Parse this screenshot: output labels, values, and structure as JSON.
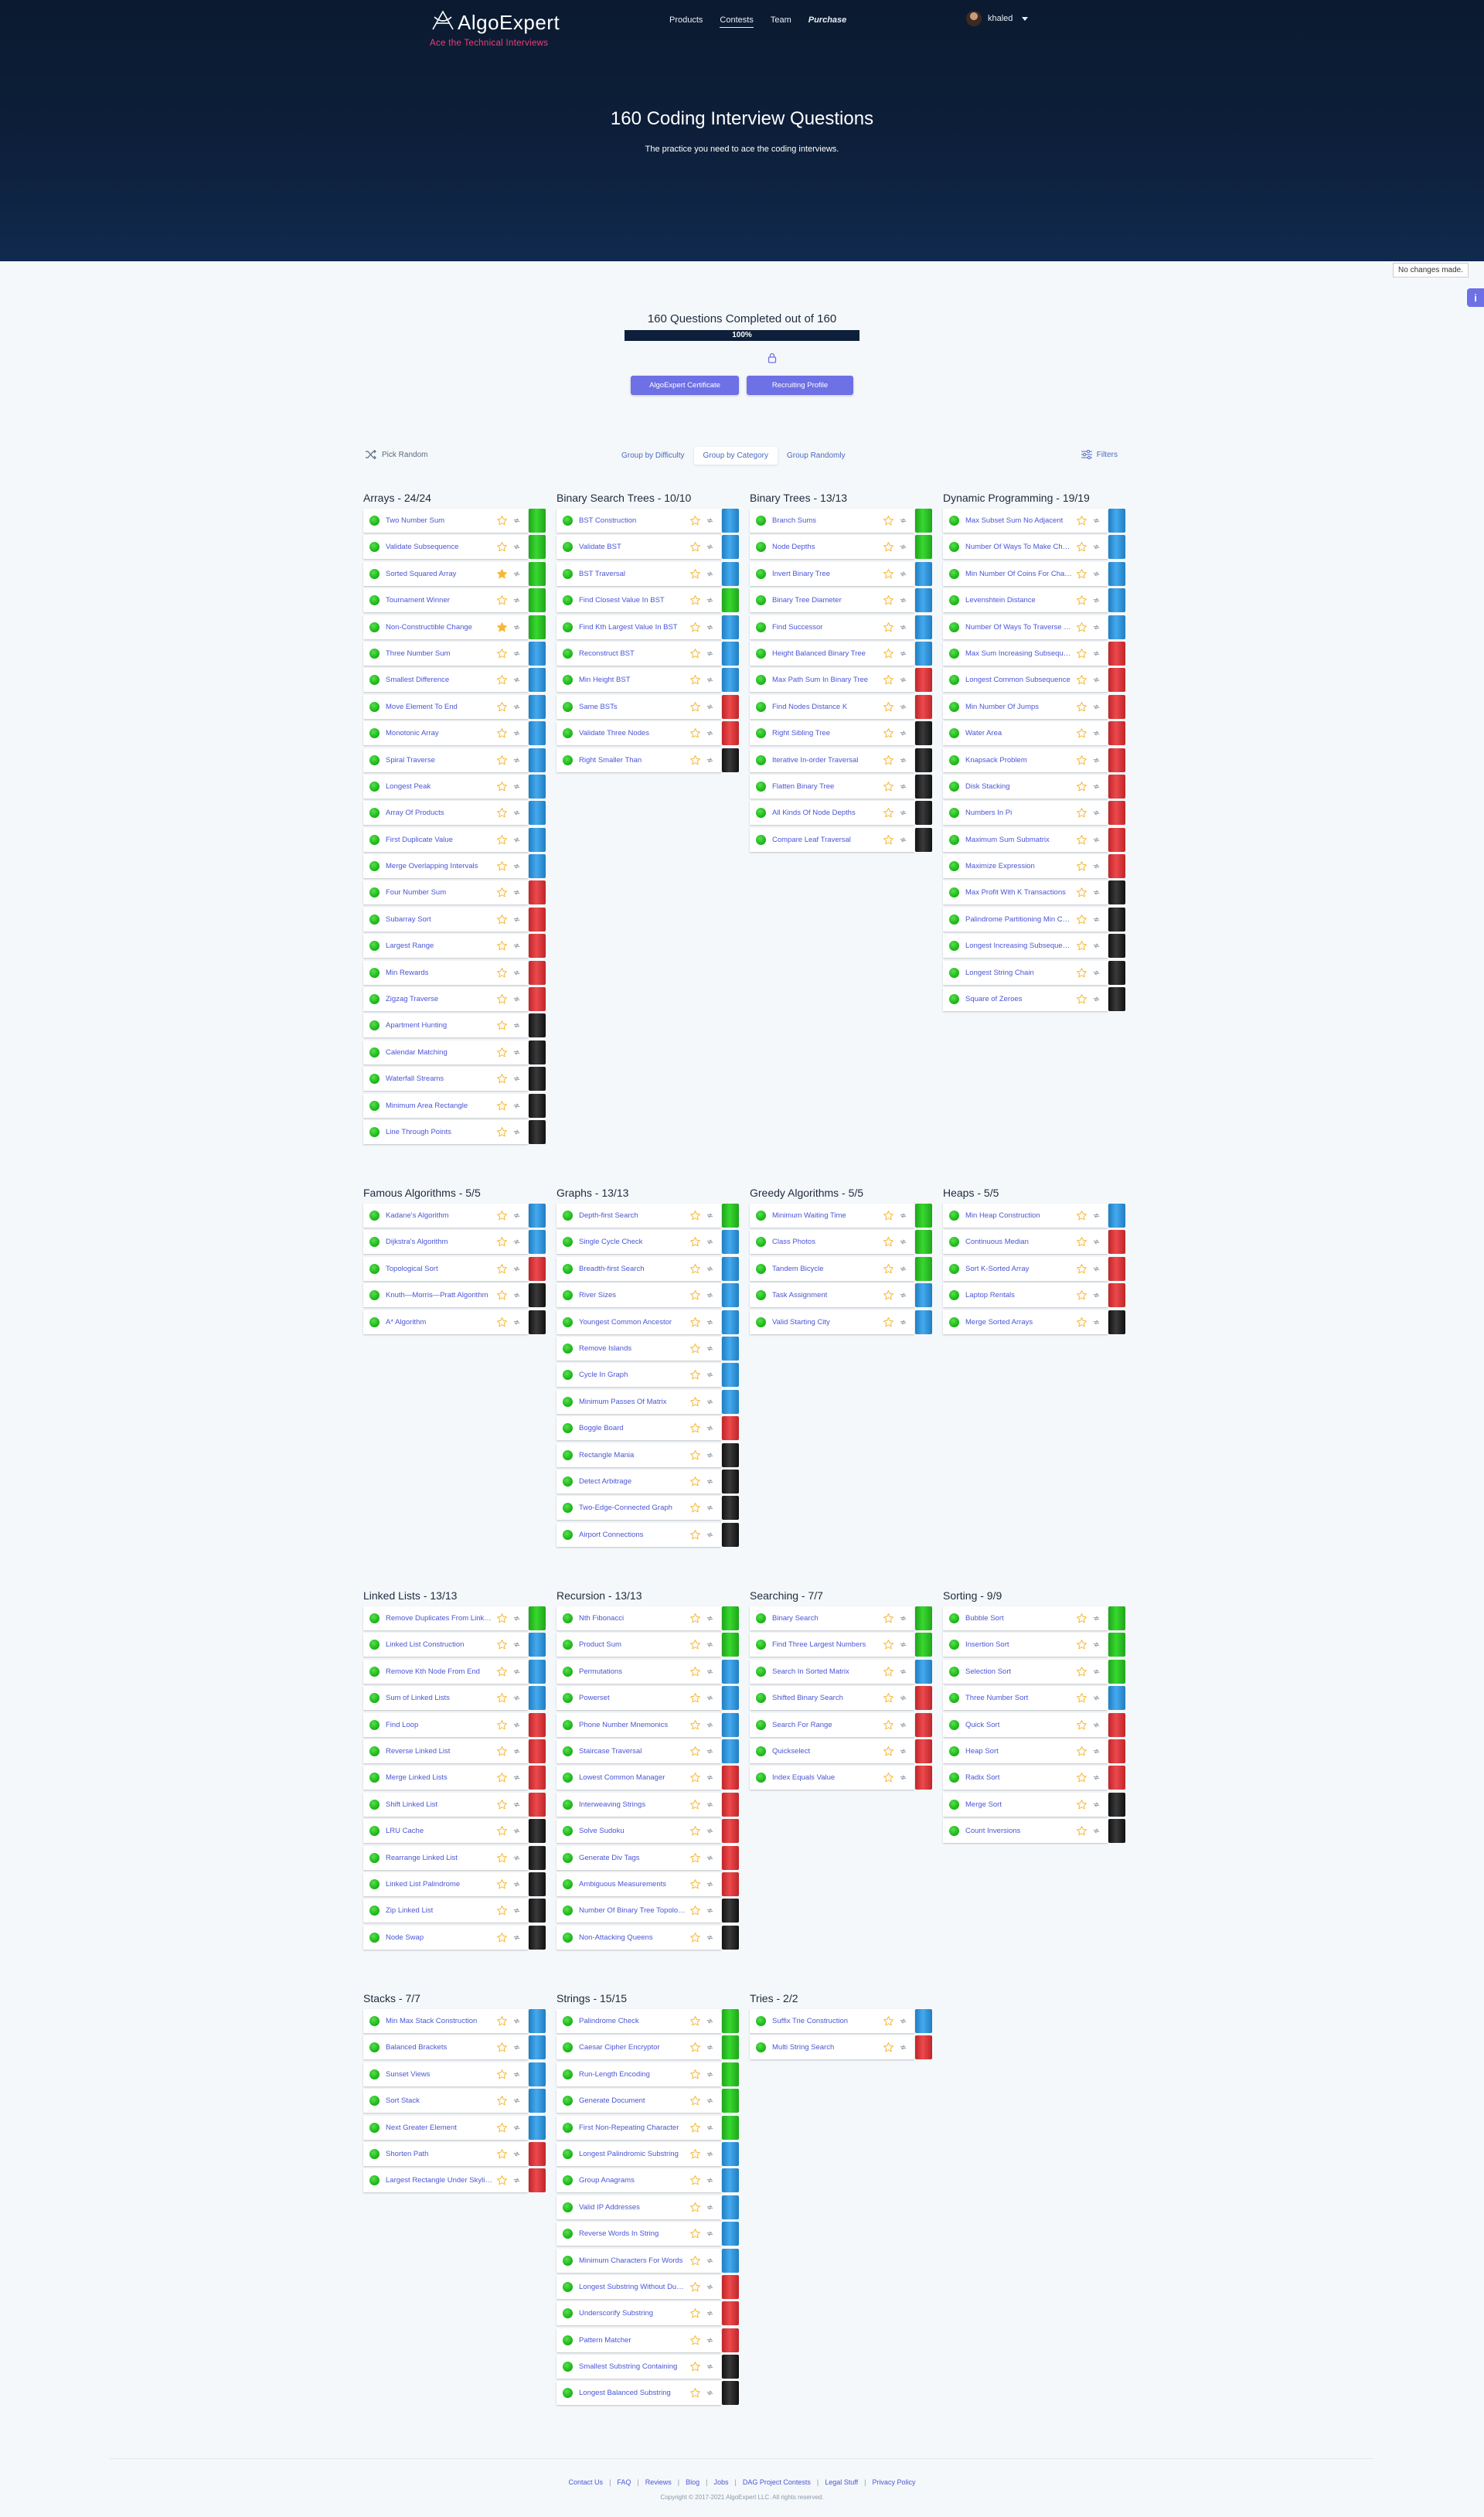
{
  "brand": {
    "name": "AlgoExpert",
    "tagline": "Ace the Technical Interviews"
  },
  "nav": {
    "products": "Products",
    "contests": "Contests",
    "team": "Team",
    "purchase": "Purchase"
  },
  "user": {
    "name": "khaled"
  },
  "hero": {
    "title": "160 Coding Interview Questions",
    "subtitle": "The practice you need to ace the coding interviews."
  },
  "toast": "No changes made.",
  "progress": {
    "title": "160 Questions Completed out of 160",
    "label": "100%",
    "fraction": 1.0
  },
  "cta": {
    "certificate": "AlgoExpert Certificate",
    "profile": "Recruiting Profile"
  },
  "toolbar": {
    "pick_random": "Pick Random",
    "group_by_difficulty": "Group by Difficulty",
    "group_by_category": "Group by Category",
    "group_randomly": "Group Randomly",
    "filters": "Filters"
  },
  "colors": {
    "easy": "#2fc62a",
    "medium": "#3a9be0",
    "hard": "#e03b3e",
    "very_hard": "#2a2a2a",
    "accent": "#6e70e5"
  },
  "categories": [
    {
      "name": "Arrays",
      "count": "24/24",
      "questions": [
        [
          "Two Number Sum",
          "easy",
          0
        ],
        [
          "Validate Subsequence",
          "easy",
          0
        ],
        [
          "Sorted Squared Array",
          "easy",
          1
        ],
        [
          "Tournament Winner",
          "easy",
          0
        ],
        [
          "Non-Constructible Change",
          "easy",
          1
        ],
        [
          "Three Number Sum",
          "medium",
          0
        ],
        [
          "Smallest Difference",
          "medium",
          0
        ],
        [
          "Move Element To End",
          "medium",
          0
        ],
        [
          "Monotonic Array",
          "medium",
          0
        ],
        [
          "Spiral Traverse",
          "medium",
          0
        ],
        [
          "Longest Peak",
          "medium",
          0
        ],
        [
          "Array Of Products",
          "medium",
          0
        ],
        [
          "First Duplicate Value",
          "medium",
          0
        ],
        [
          "Merge Overlapping Intervals",
          "medium",
          0
        ],
        [
          "Four Number Sum",
          "hard",
          0
        ],
        [
          "Subarray Sort",
          "hard",
          0
        ],
        [
          "Largest Range",
          "hard",
          0
        ],
        [
          "Min Rewards",
          "hard",
          0
        ],
        [
          "Zigzag Traverse",
          "hard",
          0
        ],
        [
          "Apartment Hunting",
          "very_hard",
          0
        ],
        [
          "Calendar Matching",
          "very_hard",
          0
        ],
        [
          "Waterfall Streams",
          "very_hard",
          0
        ],
        [
          "Minimum Area Rectangle",
          "very_hard",
          0
        ],
        [
          "Line Through Points",
          "very_hard",
          0
        ]
      ]
    },
    {
      "name": "Binary Search Trees",
      "count": "10/10",
      "questions": [
        [
          "BST Construction",
          "medium",
          0
        ],
        [
          "Validate BST",
          "medium",
          0
        ],
        [
          "BST Traversal",
          "medium",
          0
        ],
        [
          "Find Closest Value In BST",
          "easy",
          0
        ],
        [
          "Find Kth Largest Value In BST",
          "medium",
          0
        ],
        [
          "Reconstruct BST",
          "medium",
          0
        ],
        [
          "Min Height BST",
          "medium",
          0
        ],
        [
          "Same BSTs",
          "hard",
          0
        ],
        [
          "Validate Three Nodes",
          "hard",
          0
        ],
        [
          "Right Smaller Than",
          "very_hard",
          0
        ]
      ]
    },
    {
      "name": "Binary Trees",
      "count": "13/13",
      "questions": [
        [
          "Branch Sums",
          "easy",
          0
        ],
        [
          "Node Depths",
          "easy",
          0
        ],
        [
          "Invert Binary Tree",
          "medium",
          0
        ],
        [
          "Binary Tree Diameter",
          "medium",
          0
        ],
        [
          "Find Successor",
          "medium",
          0
        ],
        [
          "Height Balanced Binary Tree",
          "medium",
          0
        ],
        [
          "Max Path Sum In Binary Tree",
          "hard",
          0
        ],
        [
          "Find Nodes Distance K",
          "hard",
          0
        ],
        [
          "Right Sibling Tree",
          "very_hard",
          0
        ],
        [
          "Iterative In-order Traversal",
          "very_hard",
          0
        ],
        [
          "Flatten Binary Tree",
          "very_hard",
          0
        ],
        [
          "All Kinds Of Node Depths",
          "very_hard",
          0
        ],
        [
          "Compare Leaf Traversal",
          "very_hard",
          0
        ]
      ]
    },
    {
      "name": "Dynamic Programming",
      "count": "19/19",
      "questions": [
        [
          "Max Subset Sum No Adjacent",
          "medium",
          0
        ],
        [
          "Number Of Ways To Make Change",
          "medium",
          0
        ],
        [
          "Min Number Of Coins For Change",
          "medium",
          0
        ],
        [
          "Levenshtein Distance",
          "medium",
          0
        ],
        [
          "Number Of Ways To Traverse Graph",
          "medium",
          0
        ],
        [
          "Max Sum Increasing Subsequence",
          "hard",
          0
        ],
        [
          "Longest Common Subsequence",
          "hard",
          0
        ],
        [
          "Min Number Of Jumps",
          "hard",
          0
        ],
        [
          "Water Area",
          "hard",
          0
        ],
        [
          "Knapsack Problem",
          "hard",
          0
        ],
        [
          "Disk Stacking",
          "hard",
          0
        ],
        [
          "Numbers In Pi",
          "hard",
          0
        ],
        [
          "Maximum Sum Submatrix",
          "hard",
          0
        ],
        [
          "Maximize Expression",
          "hard",
          0
        ],
        [
          "Max Profit With K Transactions",
          "very_hard",
          0
        ],
        [
          "Palindrome Partitioning Min Cuts",
          "very_hard",
          0
        ],
        [
          "Longest Increasing Subsequence",
          "very_hard",
          0
        ],
        [
          "Longest String Chain",
          "very_hard",
          0
        ],
        [
          "Square of Zeroes",
          "very_hard",
          0
        ]
      ]
    },
    {
      "name": "Famous Algorithms",
      "count": "5/5",
      "questions": [
        [
          "Kadane's Algorithm",
          "medium",
          0
        ],
        [
          "Dijkstra's Algorithm",
          "medium",
          0
        ],
        [
          "Topological Sort",
          "hard",
          0
        ],
        [
          "Knuth—Morris—Pratt Algorithm",
          "very_hard",
          0
        ],
        [
          "A* Algorithm",
          "very_hard",
          0
        ]
      ]
    },
    {
      "name": "Graphs",
      "count": "13/13",
      "questions": [
        [
          "Depth-first Search",
          "easy",
          0
        ],
        [
          "Single Cycle Check",
          "medium",
          0
        ],
        [
          "Breadth-first Search",
          "medium",
          0
        ],
        [
          "River Sizes",
          "medium",
          0
        ],
        [
          "Youngest Common Ancestor",
          "medium",
          0
        ],
        [
          "Remove Islands",
          "medium",
          0
        ],
        [
          "Cycle In Graph",
          "medium",
          0
        ],
        [
          "Minimum Passes Of Matrix",
          "medium",
          0
        ],
        [
          "Boggle Board",
          "hard",
          0
        ],
        [
          "Rectangle Mania",
          "very_hard",
          0
        ],
        [
          "Detect Arbitrage",
          "very_hard",
          0
        ],
        [
          "Two-Edge-Connected Graph",
          "very_hard",
          0
        ],
        [
          "Airport Connections",
          "very_hard",
          0
        ]
      ]
    },
    {
      "name": "Greedy Algorithms",
      "count": "5/5",
      "questions": [
        [
          "Minimum Waiting Time",
          "easy",
          0
        ],
        [
          "Class Photos",
          "easy",
          0
        ],
        [
          "Tandem Bicycle",
          "easy",
          0
        ],
        [
          "Task Assignment",
          "medium",
          0
        ],
        [
          "Valid Starting City",
          "medium",
          0
        ]
      ]
    },
    {
      "name": "Heaps",
      "count": "5/5",
      "questions": [
        [
          "Min Heap Construction",
          "medium",
          0
        ],
        [
          "Continuous Median",
          "hard",
          0
        ],
        [
          "Sort K-Sorted Array",
          "hard",
          0
        ],
        [
          "Laptop Rentals",
          "hard",
          0
        ],
        [
          "Merge Sorted Arrays",
          "very_hard",
          0
        ]
      ]
    },
    {
      "name": "Linked Lists",
      "count": "13/13",
      "questions": [
        [
          "Remove Duplicates From Linked List",
          "easy",
          0
        ],
        [
          "Linked List Construction",
          "medium",
          0
        ],
        [
          "Remove Kth Node From End",
          "medium",
          0
        ],
        [
          "Sum of Linked Lists",
          "medium",
          0
        ],
        [
          "Find Loop",
          "hard",
          0
        ],
        [
          "Reverse Linked List",
          "hard",
          0
        ],
        [
          "Merge Linked Lists",
          "hard",
          0
        ],
        [
          "Shift Linked List",
          "hard",
          0
        ],
        [
          "LRU Cache",
          "very_hard",
          0
        ],
        [
          "Rearrange Linked List",
          "very_hard",
          0
        ],
        [
          "Linked List Palindrome",
          "very_hard",
          0
        ],
        [
          "Zip Linked List",
          "very_hard",
          0
        ],
        [
          "Node Swap",
          "very_hard",
          0
        ]
      ]
    },
    {
      "name": "Recursion",
      "count": "13/13",
      "questions": [
        [
          "Nth Fibonacci",
          "easy",
          0
        ],
        [
          "Product Sum",
          "easy",
          0
        ],
        [
          "Permutations",
          "medium",
          0
        ],
        [
          "Powerset",
          "medium",
          0
        ],
        [
          "Phone Number Mnemonics",
          "medium",
          0
        ],
        [
          "Staircase Traversal",
          "medium",
          0
        ],
        [
          "Lowest Common Manager",
          "hard",
          0
        ],
        [
          "Interweaving Strings",
          "hard",
          0
        ],
        [
          "Solve Sudoku",
          "hard",
          0
        ],
        [
          "Generate Div Tags",
          "hard",
          0
        ],
        [
          "Ambiguous Measurements",
          "hard",
          0
        ],
        [
          "Number Of Binary Tree Topologies",
          "very_hard",
          0
        ],
        [
          "Non-Attacking Queens",
          "very_hard",
          0
        ]
      ]
    },
    {
      "name": "Searching",
      "count": "7/7",
      "questions": [
        [
          "Binary Search",
          "easy",
          0
        ],
        [
          "Find Three Largest Numbers",
          "easy",
          0
        ],
        [
          "Search In Sorted Matrix",
          "medium",
          0
        ],
        [
          "Shifted Binary Search",
          "hard",
          0
        ],
        [
          "Search For Range",
          "hard",
          0
        ],
        [
          "Quickselect",
          "hard",
          0
        ],
        [
          "Index Equals Value",
          "hard",
          0
        ]
      ]
    },
    {
      "name": "Sorting",
      "count": "9/9",
      "questions": [
        [
          "Bubble Sort",
          "easy",
          0
        ],
        [
          "Insertion Sort",
          "easy",
          0
        ],
        [
          "Selection Sort",
          "easy",
          0
        ],
        [
          "Three Number Sort",
          "medium",
          0
        ],
        [
          "Quick Sort",
          "hard",
          0
        ],
        [
          "Heap Sort",
          "hard",
          0
        ],
        [
          "Radix Sort",
          "hard",
          0
        ],
        [
          "Merge Sort",
          "very_hard",
          0
        ],
        [
          "Count Inversions",
          "very_hard",
          0
        ]
      ]
    },
    {
      "name": "Stacks",
      "count": "7/7",
      "questions": [
        [
          "Min Max Stack Construction",
          "medium",
          0
        ],
        [
          "Balanced Brackets",
          "medium",
          0
        ],
        [
          "Sunset Views",
          "medium",
          0
        ],
        [
          "Sort Stack",
          "medium",
          0
        ],
        [
          "Next Greater Element",
          "medium",
          0
        ],
        [
          "Shorten Path",
          "hard",
          0
        ],
        [
          "Largest Rectangle Under Skyline",
          "hard",
          0
        ]
      ]
    },
    {
      "name": "Strings",
      "count": "15/15",
      "questions": [
        [
          "Palindrome Check",
          "easy",
          0
        ],
        [
          "Caesar Cipher Encryptor",
          "easy",
          0
        ],
        [
          "Run-Length Encoding",
          "easy",
          0
        ],
        [
          "Generate Document",
          "easy",
          0
        ],
        [
          "First Non-Repeating Character",
          "easy",
          0
        ],
        [
          "Longest Palindromic Substring",
          "medium",
          0
        ],
        [
          "Group Anagrams",
          "medium",
          0
        ],
        [
          "Valid IP Addresses",
          "medium",
          0
        ],
        [
          "Reverse Words In String",
          "medium",
          0
        ],
        [
          "Minimum Characters For Words",
          "medium",
          0
        ],
        [
          "Longest Substring Without Duplication",
          "hard",
          0
        ],
        [
          "Underscorify Substring",
          "hard",
          0
        ],
        [
          "Pattern Matcher",
          "hard",
          0
        ],
        [
          "Smallest Substring Containing",
          "very_hard",
          0
        ],
        [
          "Longest Balanced Substring",
          "very_hard",
          0
        ]
      ]
    },
    {
      "name": "Tries",
      "count": "2/2",
      "questions": [
        [
          "Suffix Trie Construction",
          "medium",
          0
        ],
        [
          "Multi String Search",
          "hard",
          0
        ]
      ]
    }
  ],
  "footer": {
    "links": [
      "Contact Us",
      "FAQ",
      "Reviews",
      "Blog",
      "Jobs",
      "DAG Project Contests",
      "Legal Stuff",
      "Privacy Policy"
    ],
    "copyright": "Copyright © 2017-2021 AlgoExpert LLC. All rights reserved."
  }
}
